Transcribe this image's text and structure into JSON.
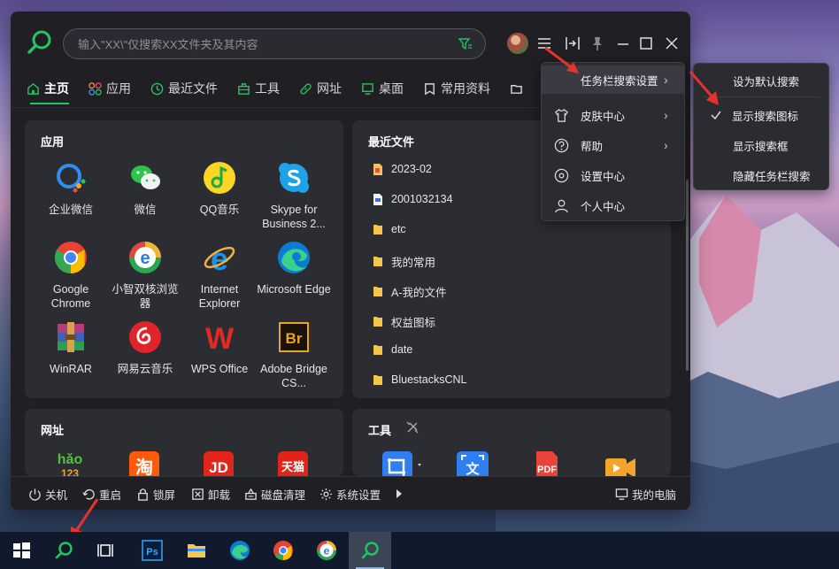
{
  "search": {
    "placeholder": "输入\"XX\\\"仅搜索XX文件夹及其内容"
  },
  "tabs": [
    {
      "label": "主页",
      "icon": "home-icon"
    },
    {
      "label": "应用",
      "icon": "apps-icon"
    },
    {
      "label": "最近文件",
      "icon": "clock-icon"
    },
    {
      "label": "工具",
      "icon": "toolbox-icon"
    },
    {
      "label": "网址",
      "icon": "link-icon"
    },
    {
      "label": "桌面",
      "icon": "monitor-icon"
    },
    {
      "label": "常用资料",
      "icon": "bookmark-icon"
    }
  ],
  "apps_panel": {
    "title": "应用",
    "apps": [
      {
        "label": "企业微信",
        "icon": "wecom-icon"
      },
      {
        "label": "微信",
        "icon": "wechat-icon"
      },
      {
        "label": "QQ音乐",
        "icon": "qqmusic-icon"
      },
      {
        "label": "Skype for Business 2...",
        "icon": "skype-icon"
      },
      {
        "label": "Google Chrome",
        "icon": "chrome-icon"
      },
      {
        "label": "小智双核浏览器",
        "icon": "xiaozhi-browser-icon"
      },
      {
        "label": "Internet Explorer",
        "icon": "ie-icon"
      },
      {
        "label": "Microsoft Edge",
        "icon": "edge-icon"
      },
      {
        "label": "WinRAR",
        "icon": "winrar-icon"
      },
      {
        "label": "网易云音乐",
        "icon": "netease-music-icon"
      },
      {
        "label": "WPS Office",
        "icon": "wps-icon"
      },
      {
        "label": "Adobe Bridge CS...",
        "icon": "adobe-bridge-icon"
      }
    ]
  },
  "recent_panel": {
    "title": "最近文件",
    "files": [
      "2023-02",
      "2001032134",
      "etc",
      "我的常用",
      "A-我的文件",
      "权益图标",
      "date",
      "BluestacksCNL"
    ]
  },
  "url_panel": {
    "title": "网址",
    "sites": [
      "hao123-icon",
      "taobao-icon",
      "jd-icon",
      "tmall-icon"
    ],
    "site_texts": {
      "hao": "hǎo",
      "hao_num": "123",
      "taobao": "淘",
      "jd": "JD",
      "tmall": "天猫"
    }
  },
  "tools_panel": {
    "title": "工具",
    "tools": [
      "screenshot-icon",
      "ocr-icon",
      "pdf-icon",
      "video-icon"
    ],
    "tool_texts": {
      "ocr": "文",
      "pdf": "PDF"
    }
  },
  "bottombar": {
    "items": [
      "关机",
      "重启",
      "锁屏",
      "卸载",
      "磁盘清理",
      "系统设置"
    ],
    "my_computer": "我的电脑"
  },
  "main_menu": {
    "items": [
      "任务栏搜索设置",
      "皮肤中心",
      "帮助",
      "设置中心",
      "个人中心"
    ]
  },
  "sub_menu": {
    "items": [
      "设为默认搜索",
      "显示搜索图标",
      "显示搜索框",
      "隐藏任务栏搜索"
    ],
    "checked_index": 1
  },
  "app_icon_texts": {
    "wps": "W",
    "bridge": "Br",
    "ie": "e",
    "xiaozhi": "e"
  },
  "taskbar": {
    "items": [
      "windows-start-icon",
      "search-icon",
      "task-view-icon",
      "photoshop-icon",
      "file-explorer-icon",
      "edge-icon",
      "chrome-icon",
      "xiaozhi-browser-icon",
      "everything-search-icon"
    ],
    "texts": {
      "photoshop": "Ps",
      "xiaozhi": "e"
    }
  },
  "colors": {
    "accent": "#22c55e",
    "annotation_arrow": "#e5322d",
    "window_bg": "#202024",
    "panel_bg": "#2c2d33"
  }
}
